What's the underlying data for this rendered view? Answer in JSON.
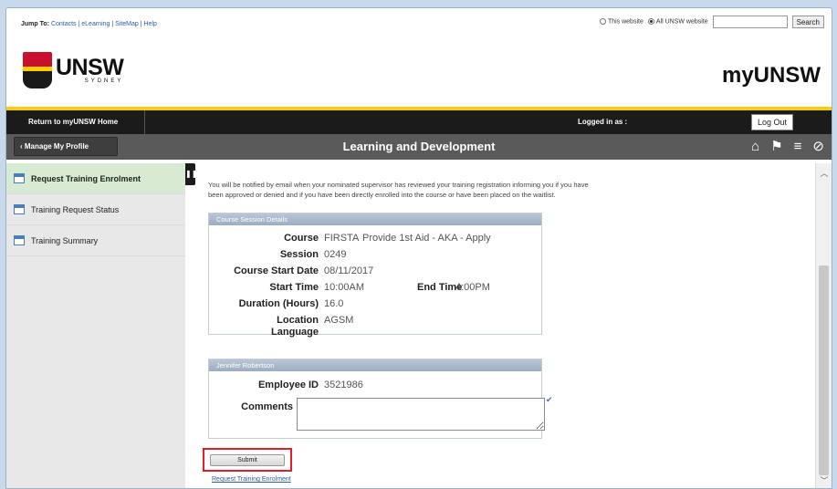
{
  "topbar": {
    "jump_label": "Jump To:",
    "links": "Contacts | eLearning | SiteMap | Help",
    "radio_this": "This website",
    "radio_all": "All UNSW website",
    "search_button": "Search"
  },
  "header": {
    "logo_text": "UNSW",
    "logo_sub": "SYDNEY",
    "site_name": "myUNSW"
  },
  "blackbar": {
    "home_link": "Return to myUNSW Home",
    "logged_in": "Logged in as :",
    "logout": "Log Out"
  },
  "greybar": {
    "manage_button": "Manage My Profile",
    "title": "Learning and Development"
  },
  "sidebar": {
    "items": [
      {
        "label": "Request Training Enrolment"
      },
      {
        "label": "Training Request Status"
      },
      {
        "label": "Training Summary"
      }
    ]
  },
  "main": {
    "notice": "You will be notified by email when your nominated supervisor has reviewed your training registration informing you if you have been approved or denied and if you have been directly enrolled into the course or have been placed on the waitlist.",
    "course_panel": {
      "header": "Course Session Details",
      "course_label": "Course",
      "course_code": "FIRSTA",
      "course_name": "Provide 1st Aid - AKA - Apply",
      "session_label": "Session",
      "session_value": "0249",
      "start_date_label": "Course Start Date",
      "start_date_value": "08/11/2017",
      "start_time_label": "Start Time",
      "start_time_value": "10:00AM",
      "end_time_label": "End Time",
      "end_time_value": "4:00PM",
      "duration_label": "Duration (Hours)",
      "duration_value": "16.0",
      "location_label": "Location",
      "location_value": "AGSM",
      "language_label": "Language"
    },
    "employee_panel": {
      "header": "Jennifer Robertson",
      "id_label": "Employee ID",
      "id_value": "3521986",
      "comments_label": "Comments"
    },
    "submit": "Submit",
    "bottom_link": "Request Training Enrolment"
  }
}
